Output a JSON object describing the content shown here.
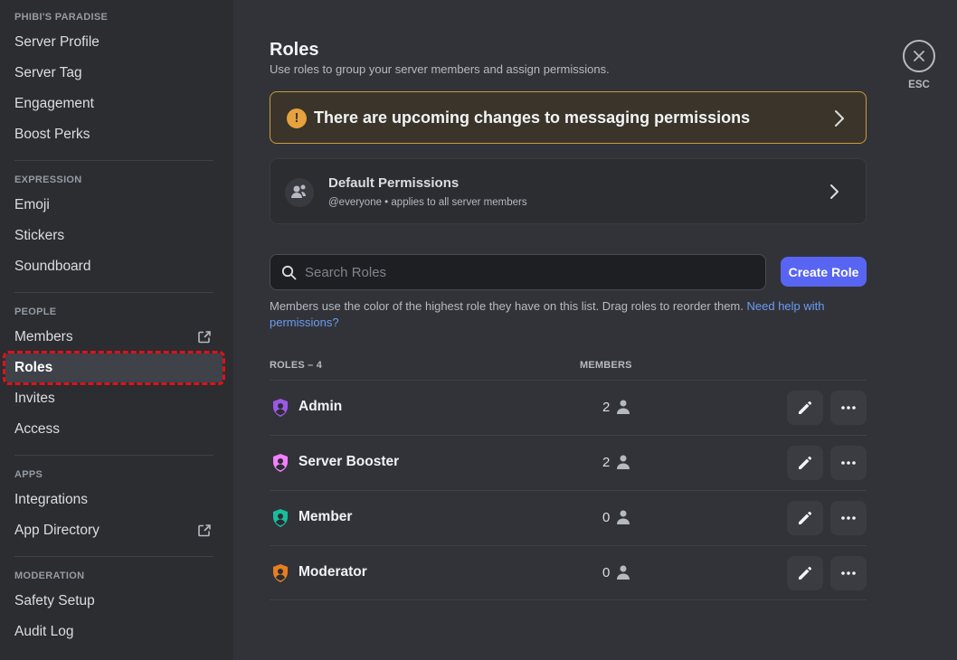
{
  "sidebar": {
    "sections": [
      {
        "header": "PHIBI'S PARADISE",
        "items": [
          {
            "label": "Server Profile",
            "external": false
          },
          {
            "label": "Server Tag",
            "external": false
          },
          {
            "label": "Engagement",
            "external": false
          },
          {
            "label": "Boost Perks",
            "external": false
          }
        ]
      },
      {
        "header": "EXPRESSION",
        "items": [
          {
            "label": "Emoji",
            "external": false
          },
          {
            "label": "Stickers",
            "external": false
          },
          {
            "label": "Soundboard",
            "external": false
          }
        ]
      },
      {
        "header": "PEOPLE",
        "items": [
          {
            "label": "Members",
            "external": true
          },
          {
            "label": "Roles",
            "external": false,
            "active": true
          },
          {
            "label": "Invites",
            "external": false
          },
          {
            "label": "Access",
            "external": false
          }
        ]
      },
      {
        "header": "APPS",
        "items": [
          {
            "label": "Integrations",
            "external": false
          },
          {
            "label": "App Directory",
            "external": true
          }
        ]
      },
      {
        "header": "MODERATION",
        "items": [
          {
            "label": "Safety Setup",
            "external": false
          },
          {
            "label": "Audit Log",
            "external": false
          }
        ]
      }
    ]
  },
  "main": {
    "title": "Roles",
    "subtitle": "Use roles to group your server members and assign permissions.",
    "notice": "There are upcoming changes to messaging permissions",
    "default_permissions": {
      "title": "Default Permissions",
      "subtitle": "@everyone • applies to all server members"
    },
    "search": {
      "placeholder": "Search Roles"
    },
    "create_button": "Create Role",
    "help_text": "Members use the color of the highest role they have on this list. Drag roles to reorder them.",
    "help_link": "Need help with permissions?",
    "roles_header": "ROLES – 4",
    "members_header": "MEMBERS",
    "roles": [
      {
        "name": "Admin",
        "members": "2",
        "color": "#9b59e6"
      },
      {
        "name": "Server Booster",
        "members": "2",
        "color": "#f47fff"
      },
      {
        "name": "Member",
        "members": "0",
        "color": "#1abc9c"
      },
      {
        "name": "Moderator",
        "members": "0",
        "color": "#e67e22"
      }
    ]
  },
  "esc": {
    "label": "ESC"
  },
  "colors": {
    "sidebar_bg": "#2b2d31",
    "main_bg": "#323339",
    "accent": "#5865f2",
    "warning": "#e6a23c",
    "highlight_outline": "#e0101a"
  }
}
